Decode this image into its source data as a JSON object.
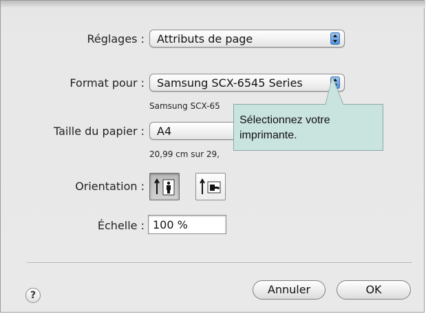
{
  "settings": {
    "label": "Réglages :",
    "value": "Attributs de page"
  },
  "format_for": {
    "label": "Format pour :",
    "value": "Samsung SCX-6545 Series",
    "detail": "Samsung SCX-65"
  },
  "paper_size": {
    "label": "Taille du papier :",
    "value": "A4",
    "detail": "20,99 cm sur 29,"
  },
  "orientation": {
    "label": "Orientation :",
    "options": [
      "portrait",
      "landscape"
    ],
    "selected": "portrait"
  },
  "scale": {
    "label": "Échelle :",
    "value": "100 %"
  },
  "buttons": {
    "cancel": "Annuler",
    "ok": "OK",
    "help": "?"
  },
  "tooltip": {
    "line1": "Sélectionnez votre",
    "line2": "imprimante."
  },
  "colors": {
    "tooltip_bg": "#c9e3df",
    "accent": "#4d8fd9"
  }
}
